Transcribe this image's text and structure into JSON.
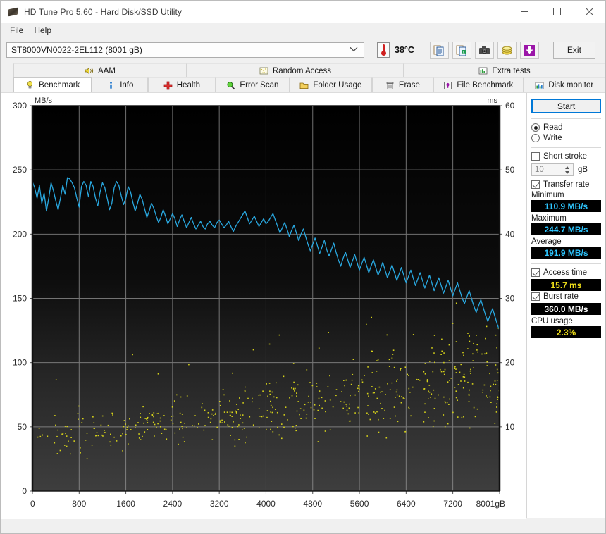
{
  "window": {
    "title": "HD Tune Pro 5.60 - Hard Disk/SSD Utility",
    "icon": "harddisk-icon",
    "minimize_label": "Minimize",
    "maximize_label": "Maximize",
    "close_label": "Close"
  },
  "menu": {
    "items": [
      {
        "label": "File"
      },
      {
        "label": "Help"
      }
    ]
  },
  "toolbar": {
    "drive": "ST8000VN0022-2EL112 (8001 gB)",
    "temperature": "38°C",
    "buttons": [
      {
        "name": "copy-report-button",
        "icon": "document-copy-icon"
      },
      {
        "name": "export-excel-button",
        "icon": "spreadsheet-export-icon"
      },
      {
        "name": "screenshot-button",
        "icon": "camera-icon"
      },
      {
        "name": "donate-button",
        "icon": "coins-icon"
      },
      {
        "name": "save-button",
        "icon": "download-arrow-icon"
      }
    ],
    "exit_label": "Exit"
  },
  "tabs_top": [
    {
      "label": "AAM",
      "icon": "speaker-icon",
      "active": false
    },
    {
      "label": "Random Access",
      "icon": "random-access-icon",
      "active": false
    },
    {
      "label": "Extra tests",
      "icon": "extra-tests-icon",
      "active": false
    }
  ],
  "tabs_bottom": [
    {
      "label": "Benchmark",
      "icon": "lightbulb-icon",
      "active": true
    },
    {
      "label": "Info",
      "icon": "info-icon",
      "active": false
    },
    {
      "label": "Health",
      "icon": "health-cross-icon",
      "active": false
    },
    {
      "label": "Error Scan",
      "icon": "magnifier-icon",
      "active": false
    },
    {
      "label": "Folder Usage",
      "icon": "folder-icon",
      "active": false
    },
    {
      "label": "Erase",
      "icon": "trash-icon",
      "active": false
    },
    {
      "label": "File Benchmark",
      "icon": "file-benchmark-icon",
      "active": false
    },
    {
      "label": "Disk monitor",
      "icon": "bar-chart-icon",
      "active": false
    }
  ],
  "sidebar": {
    "start_label": "Start",
    "mode": {
      "read_label": "Read",
      "write_label": "Write",
      "selected": "Read"
    },
    "short_stroke": {
      "label": "Short stroke",
      "checked": false,
      "value": "10",
      "unit": "gB"
    },
    "transfer_rate": {
      "label": "Transfer rate",
      "checked": true
    },
    "minimum_label": "Minimum",
    "minimum_value": "110.9 MB/s",
    "maximum_label": "Maximum",
    "maximum_value": "244.7 MB/s",
    "average_label": "Average",
    "average_value": "191.9 MB/s",
    "access_time": {
      "label": "Access time",
      "checked": true,
      "value": "15.7 ms"
    },
    "burst_rate": {
      "label": "Burst rate",
      "checked": true,
      "value": "360.0 MB/s"
    },
    "cpu_usage": {
      "label": "CPU usage",
      "value": "2.3%"
    }
  },
  "colors": {
    "transfer_line": "#29a8e0",
    "access_dots": "#d6d21a",
    "grid": "#9a9a9a",
    "result_cyan": "#2ec6ff",
    "result_yellow": "#f2e21a",
    "accent_blue": "#0078d7"
  },
  "chart_data": {
    "type": "line",
    "title": "",
    "ylabel": "MB/s",
    "y2label": "ms",
    "xlabel": "gB",
    "ylim": [
      0,
      300
    ],
    "y2lim": [
      0,
      60
    ],
    "xlim": [
      0,
      8001
    ],
    "grid": true,
    "y_ticks": [
      0,
      50,
      100,
      150,
      200,
      250,
      300
    ],
    "y2_ticks": [
      10,
      20,
      30,
      40,
      50,
      60
    ],
    "x_ticks": [
      "0",
      "800",
      "1600",
      "2400",
      "3200",
      "4000",
      "4800",
      "5600",
      "6400",
      "7200",
      "8001gB"
    ],
    "x_tick_values": [
      0,
      800,
      1600,
      2400,
      3200,
      4000,
      4800,
      5600,
      6400,
      7200,
      8001
    ],
    "series": [
      {
        "name": "Transfer rate",
        "type": "line",
        "color": "#29a8e0",
        "unit": "MB/s",
        "axis": "left",
        "x": [
          0,
          40,
          80,
          120,
          160,
          200,
          240,
          280,
          320,
          360,
          400,
          440,
          480,
          520,
          560,
          600,
          640,
          680,
          720,
          760,
          800,
          840,
          880,
          920,
          960,
          1000,
          1040,
          1080,
          1120,
          1160,
          1200,
          1240,
          1280,
          1320,
          1360,
          1400,
          1440,
          1480,
          1520,
          1560,
          1600,
          1640,
          1680,
          1720,
          1760,
          1800,
          1840,
          1880,
          1920,
          1960,
          2000,
          2040,
          2080,
          2120,
          2160,
          2200,
          2240,
          2280,
          2320,
          2360,
          2400,
          2440,
          2480,
          2520,
          2560,
          2600,
          2640,
          2680,
          2720,
          2760,
          2800,
          2840,
          2880,
          2920,
          2960,
          3000,
          3040,
          3080,
          3120,
          3160,
          3200,
          3240,
          3280,
          3320,
          3360,
          3400,
          3440,
          3480,
          3520,
          3560,
          3600,
          3640,
          3680,
          3720,
          3760,
          3800,
          3840,
          3880,
          3920,
          3960,
          4000,
          4040,
          4080,
          4120,
          4160,
          4200,
          4240,
          4280,
          4320,
          4360,
          4400,
          4440,
          4480,
          4520,
          4560,
          4600,
          4640,
          4680,
          4720,
          4760,
          4800,
          4840,
          4880,
          4920,
          4960,
          5000,
          5040,
          5080,
          5120,
          5160,
          5200,
          5240,
          5280,
          5320,
          5360,
          5400,
          5440,
          5480,
          5520,
          5560,
          5600,
          5640,
          5680,
          5720,
          5760,
          5800,
          5840,
          5880,
          5920,
          5960,
          6000,
          6040,
          6080,
          6120,
          6160,
          6200,
          6240,
          6280,
          6320,
          6360,
          6400,
          6440,
          6480,
          6520,
          6560,
          6600,
          6640,
          6680,
          6720,
          6760,
          6800,
          6840,
          6880,
          6920,
          6960,
          7000,
          7040,
          7080,
          7120,
          7160,
          7200,
          7240,
          7280,
          7320,
          7360,
          7400,
          7440,
          7480,
          7520,
          7560,
          7600,
          7640,
          7680,
          7720,
          7760,
          7800,
          7840,
          7880,
          7920,
          7960,
          8001
        ],
        "y": [
          241,
          236,
          228,
          238,
          224,
          232,
          218,
          228,
          240,
          234,
          226,
          219,
          228,
          238,
          231,
          244,
          243,
          240,
          236,
          228,
          221,
          237,
          241,
          238,
          229,
          241,
          237,
          228,
          222,
          233,
          240,
          236,
          228,
          219,
          224,
          236,
          241,
          238,
          230,
          223,
          228,
          237,
          233,
          225,
          218,
          224,
          231,
          227,
          220,
          213,
          218,
          224,
          220,
          214,
          209,
          213,
          219,
          214,
          208,
          212,
          216,
          212,
          206,
          211,
          215,
          210,
          205,
          209,
          213,
          208,
          204,
          207,
          210,
          206,
          204,
          208,
          210,
          207,
          205,
          209,
          211,
          208,
          205,
          207,
          210,
          206,
          202,
          206,
          209,
          212,
          215,
          218,
          213,
          208,
          211,
          214,
          210,
          206,
          209,
          212,
          208,
          210,
          213,
          216,
          211,
          206,
          201,
          205,
          209,
          204,
          198,
          203,
          207,
          201,
          195,
          200,
          204,
          198,
          192,
          187,
          192,
          197,
          191,
          185,
          190,
          195,
          188,
          183,
          188,
          193,
          186,
          180,
          175,
          181,
          186,
          180,
          174,
          179,
          184,
          178,
          172,
          177,
          182,
          176,
          170,
          175,
          180,
          174,
          168,
          173,
          178,
          172,
          166,
          171,
          176,
          170,
          164,
          169,
          174,
          168,
          162,
          167,
          172,
          166,
          160,
          165,
          170,
          164,
          158,
          163,
          168,
          162,
          156,
          161,
          166,
          160,
          154,
          159,
          164,
          158,
          152,
          157,
          162,
          156,
          150,
          146,
          151,
          156,
          150,
          144,
          139,
          144,
          149,
          143,
          137,
          132,
          137,
          142,
          136,
          130,
          125,
          130,
          135,
          129,
          123,
          118,
          124,
          130,
          125,
          119,
          113,
          118,
          124,
          119,
          114
        ]
      },
      {
        "name": "Access time",
        "type": "scatter",
        "color": "#d6d21a",
        "unit": "ms",
        "axis": "right",
        "average": 15.7,
        "description": "Scatter cloud of random-access seek latencies; rises from roughly 7-12 ms at the start of the disk to roughly 16-26 ms near the end, with a dense band and scattered outliers up to ~30 ms.",
        "range_ms": [
          5,
          30
        ]
      }
    ]
  }
}
